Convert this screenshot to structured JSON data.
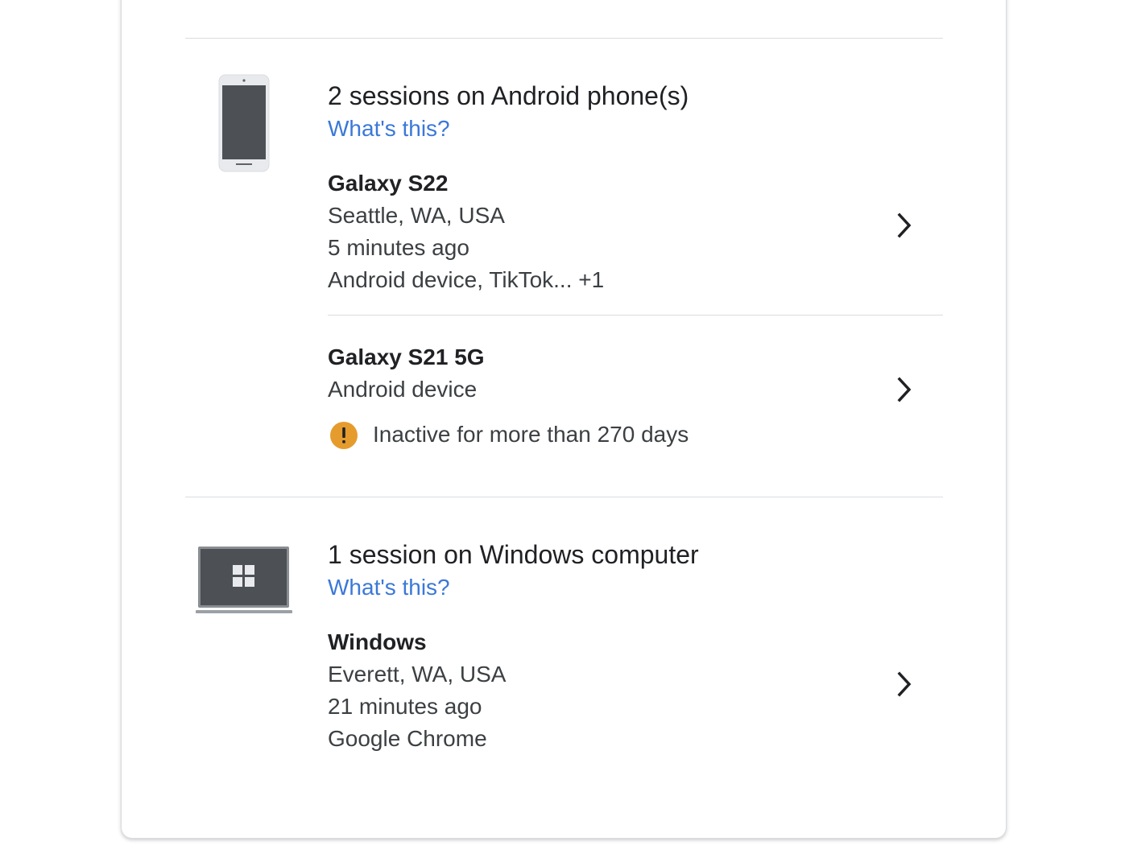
{
  "groups": [
    {
      "icon": "android-phone-icon",
      "title": "2 sessions on Android phone(s)",
      "link": "What's this?",
      "devices": [
        {
          "name": "Galaxy S22",
          "lines": [
            "Seattle, WA, USA",
            "5 minutes ago",
            "Android device, TikTok... +1"
          ]
        },
        {
          "name": "Galaxy S21 5G",
          "lines": [
            "Android device"
          ],
          "warning": {
            "icon": "warning-icon",
            "text": "Inactive for more than 270 days",
            "color": "#e59c2d"
          }
        }
      ]
    },
    {
      "icon": "windows-computer-icon",
      "title": "1 session on Windows computer",
      "link": "What's this?",
      "devices": [
        {
          "name": "Windows",
          "lines": [
            "Everett, WA, USA",
            "21 minutes ago",
            "Google Chrome"
          ]
        }
      ]
    }
  ],
  "colors": {
    "link": "#3b78d8",
    "divider": "#dadce0",
    "warning": "#e59c2d"
  }
}
